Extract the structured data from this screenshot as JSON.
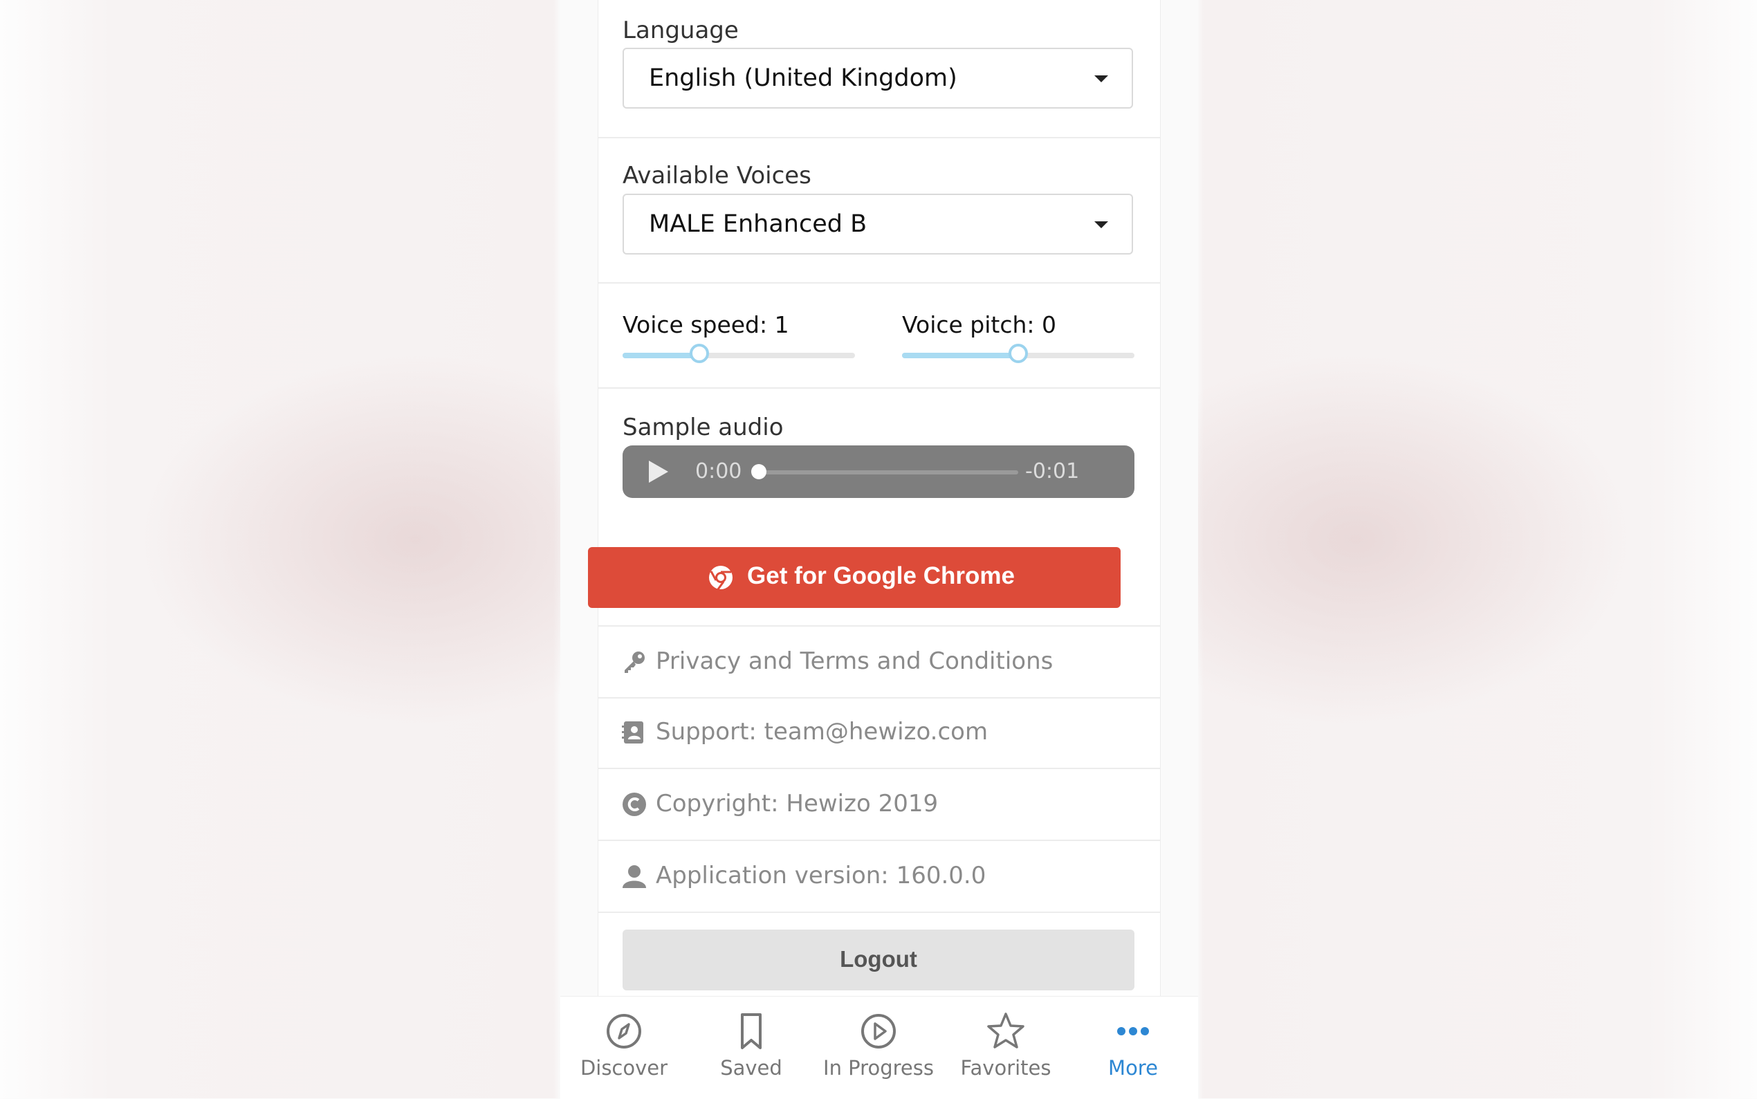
{
  "settings": {
    "language": {
      "label": "Language",
      "value": "English (United Kingdom)"
    },
    "voices": {
      "label": "Available Voices",
      "value": "MALE Enhanced B"
    },
    "voice_speed": {
      "label": "Voice speed: 1",
      "value": 1,
      "fill_fraction": 0.33
    },
    "voice_pitch": {
      "label": "Voice pitch: 0",
      "value": 0,
      "fill_fraction": 0.5
    },
    "sample_audio": {
      "label": "Sample audio",
      "current_time": "0:00",
      "remaining_time": "-0:01",
      "progress": 0
    }
  },
  "chrome_button": {
    "label": "Get for Google Chrome",
    "icon": "chrome-icon",
    "color": "#dd4b39"
  },
  "info": [
    {
      "icon": "key-icon",
      "text": "Privacy and Terms and Conditions"
    },
    {
      "icon": "contact-icon",
      "text": "Support: team@hewizo.com"
    },
    {
      "icon": "copyright-icon",
      "text": "Copyright: Hewizo 2019"
    },
    {
      "icon": "user-icon",
      "text": "Application version: 160.0.0"
    }
  ],
  "logout": {
    "label": "Logout"
  },
  "tabbar": {
    "items": [
      {
        "label": "Discover",
        "icon": "compass-icon"
      },
      {
        "label": "Saved",
        "icon": "bookmark-icon"
      },
      {
        "label": "In Progress",
        "icon": "play-circle-icon"
      },
      {
        "label": "Favorites",
        "icon": "star-icon"
      },
      {
        "label": "More",
        "icon": "more-icon",
        "active": true
      }
    ],
    "active_color": "#2d87d3"
  }
}
